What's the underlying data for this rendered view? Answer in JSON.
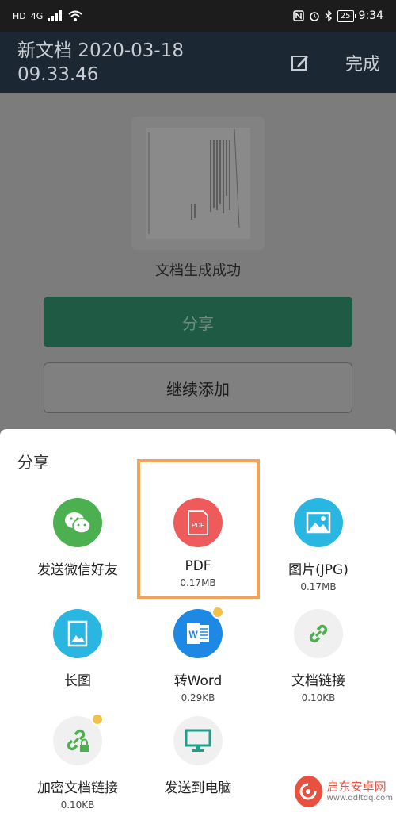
{
  "status_bar": {
    "network": "HD",
    "signal_type": "4G",
    "time": "9:34",
    "battery": "25"
  },
  "header": {
    "title": "新文档 2020-03-18 09.33.46",
    "done_label": "完成",
    "edit_icon": "edit-icon"
  },
  "main": {
    "success_text": "文档生成成功",
    "share_label": "分享",
    "continue_label": "继续添加"
  },
  "share_sheet": {
    "title": "分享",
    "options": [
      {
        "label": "发送微信好友",
        "size": "",
        "icon": "wechat-icon",
        "color": "#4caf50"
      },
      {
        "label": "PDF",
        "size": "0.17MB",
        "icon": "pdf-icon",
        "color": "#ef5b5b"
      },
      {
        "label": "图片(JPG)",
        "size": "0.17MB",
        "icon": "image-icon",
        "color": "#29b6e0"
      },
      {
        "label": "长图",
        "size": "",
        "icon": "long-image-icon",
        "color": "#29b6e0"
      },
      {
        "label": "转Word",
        "size": "0.29KB",
        "icon": "word-icon",
        "color": "#1e88e5"
      },
      {
        "label": "文档链接",
        "size": "0.10KB",
        "icon": "link-icon",
        "color": "#4caf50"
      },
      {
        "label": "加密文档链接",
        "size": "0.10KB",
        "icon": "lock-link-icon",
        "color": "#4caf50"
      },
      {
        "label": "发送到电脑",
        "size": "",
        "icon": "computer-icon",
        "color": "#4caf50"
      }
    ]
  },
  "watermark": {
    "name": "启东安卓网",
    "url": "www.qdltdq.com"
  }
}
